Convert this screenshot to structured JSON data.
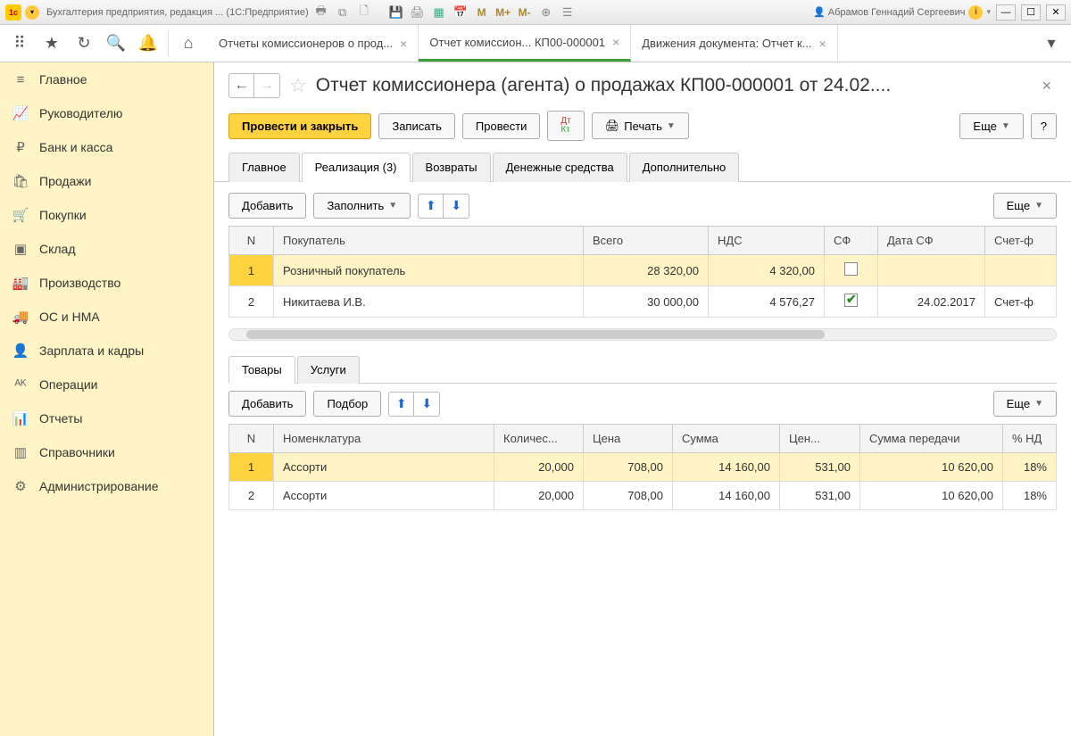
{
  "titlebar": {
    "app_title": "Бухгалтерия предприятия, редакция ... (1С:Предприятие)",
    "user_name": "Абрамов Геннадий Сергеевич",
    "m": "M",
    "mplus": "M+",
    "mminus": "M-"
  },
  "doc_tabs": [
    {
      "label": "Отчеты комиссионеров о прод..."
    },
    {
      "label": "Отчет комиссион... КП00-000001"
    },
    {
      "label": "Движения документа: Отчет к..."
    }
  ],
  "sidebar": {
    "items": [
      {
        "icon": "≡",
        "label": "Главное"
      },
      {
        "icon": "📈",
        "label": "Руководителю"
      },
      {
        "icon": "₽",
        "label": "Банк и касса"
      },
      {
        "icon": "🛍",
        "label": "Продажи"
      },
      {
        "icon": "🛒",
        "label": "Покупки"
      },
      {
        "icon": "▣",
        "label": "Склад"
      },
      {
        "icon": "🏭",
        "label": "Производство"
      },
      {
        "icon": "🚚",
        "label": "ОС и НМА"
      },
      {
        "icon": "👤",
        "label": "Зарплата и кадры"
      },
      {
        "icon": "ᴬᴷ",
        "label": "Операции"
      },
      {
        "icon": "📊",
        "label": "Отчеты"
      },
      {
        "icon": "▥",
        "label": "Справочники"
      },
      {
        "icon": "⚙",
        "label": "Администрирование"
      }
    ]
  },
  "document": {
    "title": "Отчет комиссионера (агента) о продажах КП00-000001 от 24.02....",
    "actions": {
      "post_close": "Провести и закрыть",
      "save": "Записать",
      "post": "Провести",
      "print": "Печать",
      "more": "Еще",
      "help": "?"
    },
    "section_tabs": [
      "Главное",
      "Реализация (3)",
      "Возвраты",
      "Денежные средства",
      "Дополнительно"
    ],
    "table_actions": {
      "add": "Добавить",
      "fill": "Заполнить",
      "more": "Еще"
    },
    "buyers_table": {
      "headers": [
        "N",
        "Покупатель",
        "Всего",
        "НДС",
        "СФ",
        "Дата СФ",
        "Счет-ф"
      ],
      "rows": [
        {
          "n": "1",
          "buyer": "Розничный покупатель",
          "total": "28 320,00",
          "vat": "4 320,00",
          "sf": false,
          "sf_date": "",
          "invoice": ""
        },
        {
          "n": "2",
          "buyer": "Никитаева И.В.",
          "total": "30 000,00",
          "vat": "4 576,27",
          "sf": true,
          "sf_date": "24.02.2017",
          "invoice": "Счет-ф"
        }
      ]
    },
    "sub_tabs": [
      "Товары",
      "Услуги"
    ],
    "goods_actions": {
      "add": "Добавить",
      "select": "Подбор",
      "more": "Еще"
    },
    "goods_table": {
      "headers": [
        "N",
        "Номенклатура",
        "Количес...",
        "Цена",
        "Сумма",
        "Цен...",
        "Сумма передачи",
        "% НД"
      ],
      "rows": [
        {
          "n": "1",
          "item": "Ассорти",
          "qty": "20,000",
          "price": "708,00",
          "sum": "14 160,00",
          "tprice": "531,00",
          "tsum": "10 620,00",
          "vat": "18%"
        },
        {
          "n": "2",
          "item": "Ассорти",
          "qty": "20,000",
          "price": "708,00",
          "sum": "14 160,00",
          "tprice": "531,00",
          "tsum": "10 620,00",
          "vat": "18%"
        }
      ]
    }
  }
}
